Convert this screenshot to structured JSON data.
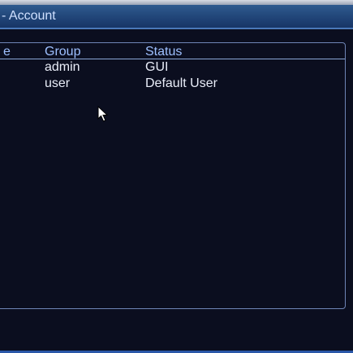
{
  "window": {
    "title": "Account"
  },
  "table": {
    "headers": [
      "e",
      "Group",
      "Status"
    ],
    "rows": [
      {
        "group": "admin",
        "status": "GUI"
      },
      {
        "group": "user",
        "status": "Default User"
      }
    ]
  },
  "colors": {
    "background": "#0b0e1f",
    "title_bar": "#23497c",
    "header_text": "#9ec0ff",
    "row_text": "#e9edf8",
    "border": "#6f85b6"
  }
}
